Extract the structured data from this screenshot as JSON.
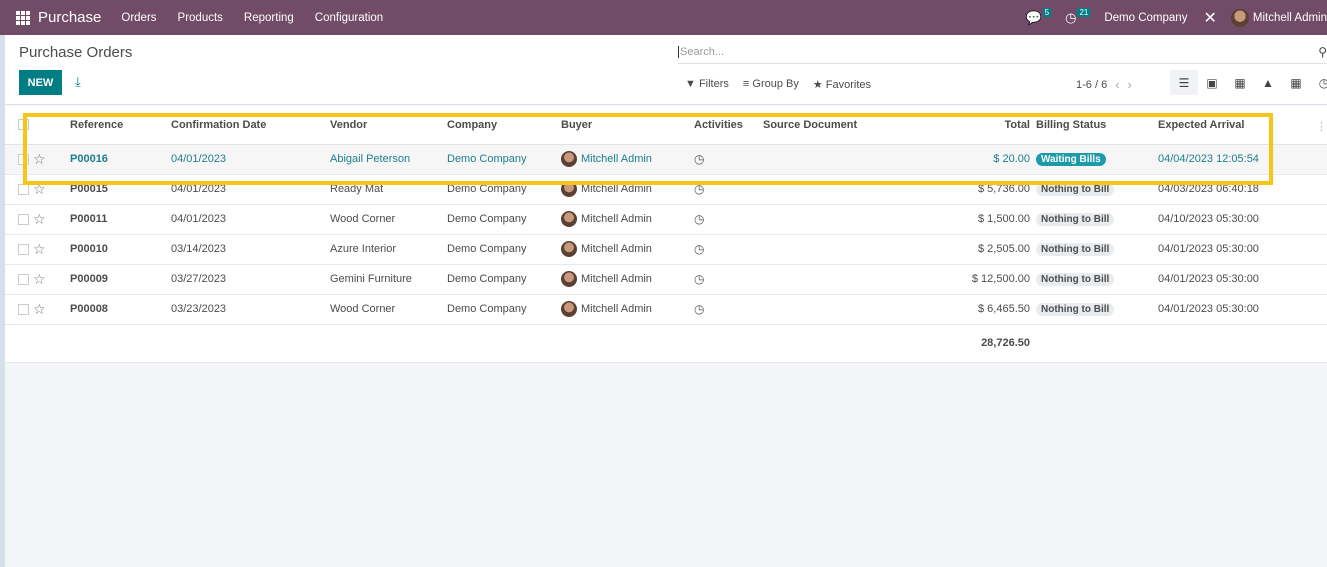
{
  "navbar": {
    "app_name": "Purchase",
    "menu": [
      "Orders",
      "Products",
      "Reporting",
      "Configuration"
    ],
    "messages_count": "5",
    "activities_count": "21",
    "company": "Demo Company",
    "user": "Mitchell Admin"
  },
  "control": {
    "title": "Purchase Orders",
    "new_label": "NEW",
    "search_placeholder": "Search...",
    "filters_label": "Filters",
    "groupby_label": "Group By",
    "favorites_label": "Favorites",
    "pager": "1-6 / 6",
    "views": [
      "list-view",
      "kanban-view",
      "pivot-view",
      "graph-view",
      "calendar-view",
      "activity-view"
    ]
  },
  "table": {
    "headers": [
      "Reference",
      "Confirmation Date",
      "Vendor",
      "Company",
      "Buyer",
      "Activities",
      "Source Document",
      "Total",
      "Billing Status",
      "Expected Arrival"
    ],
    "rows": [
      {
        "ref": "P00016",
        "date": "04/01/2023",
        "vendor": "Abigail Peterson",
        "company": "Demo Company",
        "buyer": "Mitchell Admin",
        "source": "",
        "total": "$ 20.00",
        "status": "Waiting Bills",
        "arrival": "04/04/2023 12:05:54"
      },
      {
        "ref": "P00015",
        "date": "04/01/2023",
        "vendor": "Ready Mat",
        "company": "Demo Company",
        "buyer": "Mitchell Admin",
        "source": "",
        "total": "$ 5,736.00",
        "status": "Nothing to Bill",
        "arrival": "04/03/2023 06:40:18"
      },
      {
        "ref": "P00011",
        "date": "04/01/2023",
        "vendor": "Wood Corner",
        "company": "Demo Company",
        "buyer": "Mitchell Admin",
        "source": "",
        "total": "$ 1,500.00",
        "status": "Nothing to Bill",
        "arrival": "04/10/2023 05:30:00"
      },
      {
        "ref": "P00010",
        "date": "03/14/2023",
        "vendor": "Azure Interior",
        "company": "Demo Company",
        "buyer": "Mitchell Admin",
        "source": "",
        "total": "$ 2,505.00",
        "status": "Nothing to Bill",
        "arrival": "04/01/2023 05:30:00"
      },
      {
        "ref": "P00009",
        "date": "03/27/2023",
        "vendor": "Gemini Furniture",
        "company": "Demo Company",
        "buyer": "Mitchell Admin",
        "source": "",
        "total": "$ 12,500.00",
        "status": "Nothing to Bill",
        "arrival": "04/01/2023 05:30:00"
      },
      {
        "ref": "P00008",
        "date": "03/23/2023",
        "vendor": "Wood Corner",
        "company": "Demo Company",
        "buyer": "Mitchell Admin",
        "source": "",
        "total": "$ 6,465.50",
        "status": "Nothing to Bill",
        "arrival": "04/01/2023 05:30:00"
      }
    ],
    "grand_total": "28,726.50"
  },
  "colors": {
    "navbar": "#714b67",
    "primary": "#017e84",
    "link": "#1b7f8b",
    "highlight": "#f7c518"
  }
}
